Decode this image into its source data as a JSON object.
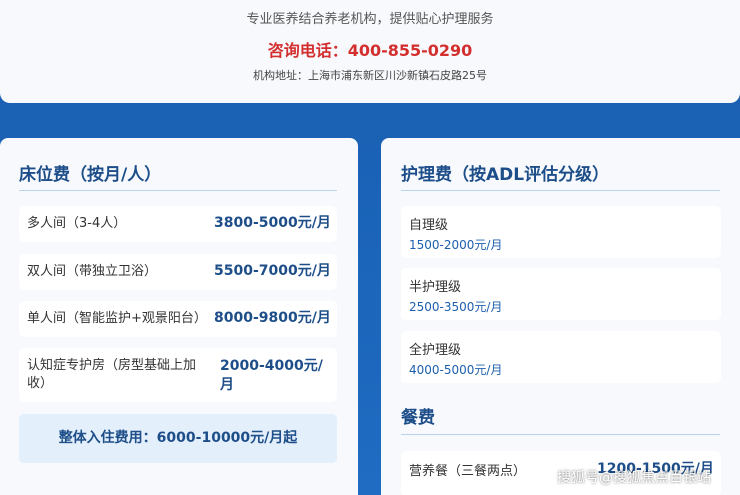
{
  "header": {
    "slogan": "专业医养结合养老机构，提供贴心护理服务",
    "phone": "咨询电话：400-855-0290",
    "address": "机构地址：上海市浦东新区川沙新镇石皮路25号"
  },
  "bed_fees": {
    "title": "床位费（按月/人）",
    "items": [
      {
        "label": "多人间（3-4人）",
        "value": "3800-5000元/月"
      },
      {
        "label": "双人间（带独立卫浴）",
        "value": "5500-7000元/月"
      },
      {
        "label": "单人间（智能监护+观景阳台）",
        "value": "8000-9800元/月"
      },
      {
        "label": "认知症专护房（房型基础上加收）",
        "value": "2000-4000元/月"
      }
    ],
    "total": "整体入住费用：6000-10000元/月起"
  },
  "care_fees": {
    "title": "护理费（按ADL评估分级）",
    "items": [
      {
        "name": "自理级",
        "range": "1500-2000元/月"
      },
      {
        "name": "半护理级",
        "range": "2500-3500元/月"
      },
      {
        "name": "全护理级",
        "range": "4000-5000元/月"
      }
    ]
  },
  "meal_fees": {
    "title": "餐费",
    "items": [
      {
        "name": "营养餐（三餐两点）",
        "value": "1200-1500元/月"
      }
    ]
  },
  "watermark": "搜狐号@搜狐焦点百银站"
}
